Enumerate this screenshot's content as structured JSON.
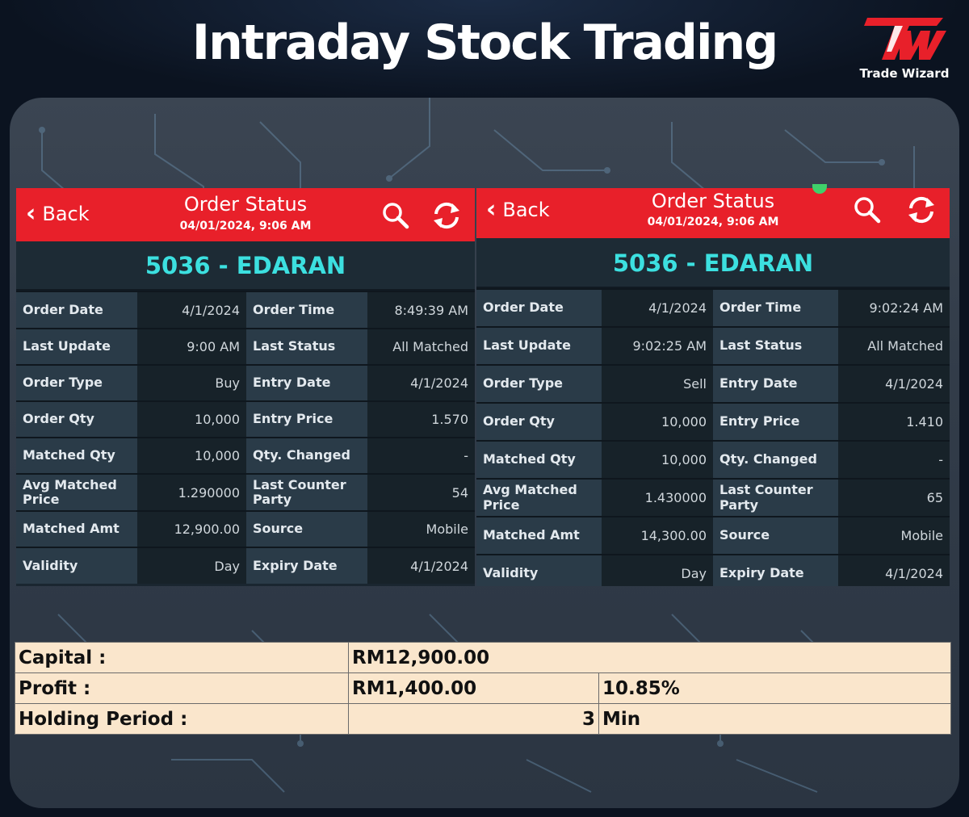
{
  "page": {
    "title": "Intraday Stock Trading"
  },
  "logo": {
    "name": "Trade Wizard",
    "mark_color": "#e8202a"
  },
  "screens": [
    {
      "header": {
        "back_label": "Back",
        "title": "Order Status",
        "subtitle": "04/01/2024, 9:06 AM",
        "icons": [
          "search-icon",
          "refresh-icon"
        ]
      },
      "stock": "5036 - EDARAN",
      "rows": [
        [
          "Order Date",
          "4/1/2024",
          "Order Time",
          "8:49:39 AM"
        ],
        [
          "Last Update",
          "9:00 AM",
          "Last Status",
          "All Matched"
        ],
        [
          "Order Type",
          "Buy",
          "Entry Date",
          "4/1/2024"
        ],
        [
          "Order Qty",
          "10,000",
          "Entry Price",
          "1.570"
        ],
        [
          "Matched Qty",
          "10,000",
          "Qty. Changed",
          "-"
        ],
        [
          "Avg Matched Price",
          "1.290000",
          "Last Counter Party",
          "54"
        ],
        [
          "Matched Amt",
          "12,900.00",
          "Source",
          "Mobile"
        ],
        [
          "Validity",
          "Day",
          "Expiry Date",
          "4/1/2024"
        ]
      ]
    },
    {
      "header": {
        "back_label": "Back",
        "title": "Order Status",
        "subtitle": "04/01/2024, 9:06 AM",
        "icons": [
          "search-icon",
          "refresh-icon"
        ]
      },
      "stock": "5036 - EDARAN",
      "rows": [
        [
          "Order Date",
          "4/1/2024",
          "Order Time",
          "9:02:24 AM"
        ],
        [
          "Last Update",
          "9:02:25 AM",
          "Last Status",
          "All Matched"
        ],
        [
          "Order Type",
          "Sell",
          "Entry Date",
          "4/1/2024"
        ],
        [
          "Order Qty",
          "10,000",
          "Entry Price",
          "1.410"
        ],
        [
          "Matched Qty",
          "10,000",
          "Qty. Changed",
          "-"
        ],
        [
          "Avg Matched Price",
          "1.430000",
          "Last Counter Party",
          "65"
        ],
        [
          "Matched Amt",
          "14,300.00",
          "Source",
          "Mobile"
        ],
        [
          "Validity",
          "Day",
          "Expiry Date",
          "4/1/2024"
        ]
      ]
    }
  ],
  "summary": {
    "capital_label": "Capital :",
    "capital_value": "RM12,900.00",
    "profit_label": "Profit :",
    "profit_value": "RM1,400.00",
    "profit_pct": "10.85%",
    "holding_label": "Holding Period :",
    "holding_value": "3",
    "holding_unit": "Min"
  },
  "colors": {
    "header_red": "#e8202a",
    "stock_cyan": "#3ce0e0",
    "summary_bg": "#fae6cc"
  }
}
